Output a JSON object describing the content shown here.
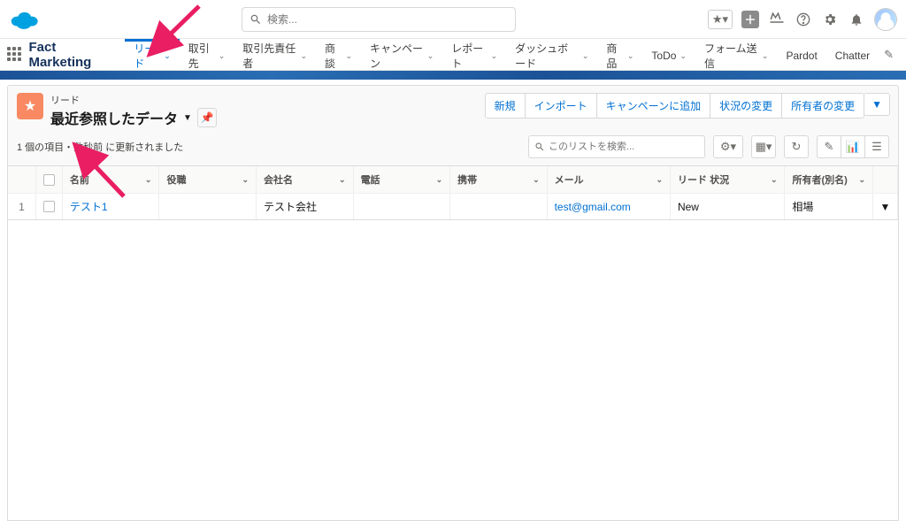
{
  "search": {
    "placeholder": "検索..."
  },
  "app_name": "Fact Marketing",
  "nav": [
    {
      "label": "リード",
      "active": true
    },
    {
      "label": "取引先",
      "active": false
    },
    {
      "label": "取引先責任者",
      "active": false
    },
    {
      "label": "商談",
      "active": false
    },
    {
      "label": "キャンペーン",
      "active": false
    },
    {
      "label": "レポート",
      "active": false
    },
    {
      "label": "ダッシュボード",
      "active": false
    },
    {
      "label": "商品",
      "active": false
    },
    {
      "label": "ToDo",
      "active": false
    },
    {
      "label": "フォーム送信",
      "active": false
    },
    {
      "label": "Pardot",
      "active": false,
      "nochev": true
    },
    {
      "label": "Chatter",
      "active": false,
      "nochev": true
    }
  ],
  "object_label": "リード",
  "view_name": "最近参照したデータ",
  "status_text": "1 個の項目・数秒前 に更新されました",
  "list_search_placeholder": "このリストを検索...",
  "action_buttons": [
    "新規",
    "インポート",
    "キャンペーンに追加",
    "状況の変更",
    "所有者の変更"
  ],
  "columns": {
    "name": "名前",
    "role": "役職",
    "company": "会社名",
    "phone": "電話",
    "mobile": "携帯",
    "email": "メール",
    "status": "リード 状況",
    "owner": "所有者(別名)"
  },
  "rows": [
    {
      "num": "1",
      "name": "テスト1",
      "role": "",
      "company": "テスト会社",
      "phone": "",
      "mobile": "",
      "email": "test@gmail.com",
      "status": "New",
      "owner": "相場"
    }
  ]
}
